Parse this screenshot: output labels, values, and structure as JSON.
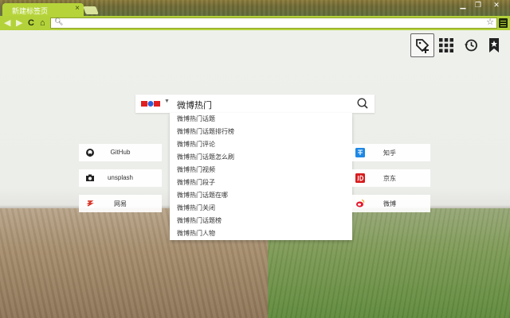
{
  "browser": {
    "tab_title": "新建标签页",
    "tab_close": "×",
    "win_min": "▁",
    "win_max": "❐",
    "win_close": "✕",
    "omnibox_value": ""
  },
  "search": {
    "engine": "Baidu",
    "query": "微博热门",
    "suggestions": [
      "微博热门话题",
      "微博热门话题排行榜",
      "微博热门评论",
      "微博热门话题怎么刷",
      "微博热门视频",
      "微博热门段子",
      "微博热门话题在哪",
      "微博热门关闭",
      "微博热门话题榜",
      "微博热门人物"
    ]
  },
  "quick_links": {
    "left": [
      {
        "label": "GitHub",
        "icon": "github-icon"
      },
      {
        "label": "unsplash",
        "icon": "camera-icon"
      },
      {
        "label": "网易",
        "icon": "netease-icon"
      }
    ],
    "right": [
      {
        "label": "知乎",
        "icon": "zhihu-icon"
      },
      {
        "label": "京东",
        "icon": "jd-icon"
      },
      {
        "label": "微博",
        "icon": "weibo-icon"
      }
    ]
  },
  "tools": [
    "add-site-icon",
    "apps-grid-icon",
    "history-icon",
    "bookmark-icon"
  ],
  "colors": {
    "toolbar": "#b3d23a",
    "tab": "#b6d43a"
  }
}
